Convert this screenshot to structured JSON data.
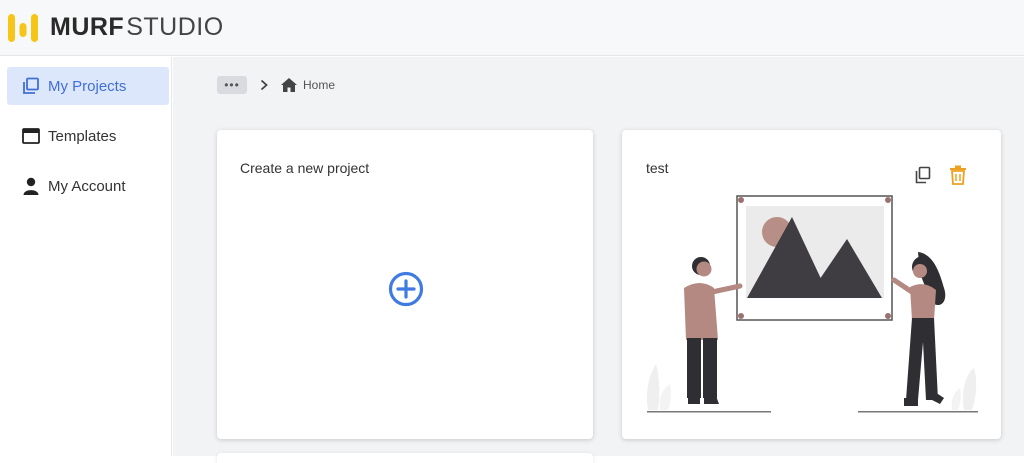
{
  "header": {
    "brand_bold": "MURF",
    "brand_light": "STUDIO",
    "colors": {
      "logo_yellow": "#f5c518"
    }
  },
  "sidebar": {
    "items": [
      {
        "label": "My Projects",
        "icon": "projects-icon",
        "active": true
      },
      {
        "label": "Templates",
        "icon": "template-icon",
        "active": false
      },
      {
        "label": "My Account",
        "icon": "user-icon",
        "active": false
      }
    ],
    "colors": {
      "active_bg": "#dde7fb",
      "active_text": "#3f6fd8"
    }
  },
  "breadcrumb": {
    "more": "•••",
    "home": "Home"
  },
  "cards": {
    "new_project": {
      "title": "Create a new project",
      "icon": "plus-circle-icon"
    },
    "project": {
      "title": "test",
      "actions": [
        "copy-icon",
        "delete-icon"
      ]
    }
  },
  "colors": {
    "accent_blue": "#3f7be0",
    "delete_orange": "#f0a020"
  }
}
